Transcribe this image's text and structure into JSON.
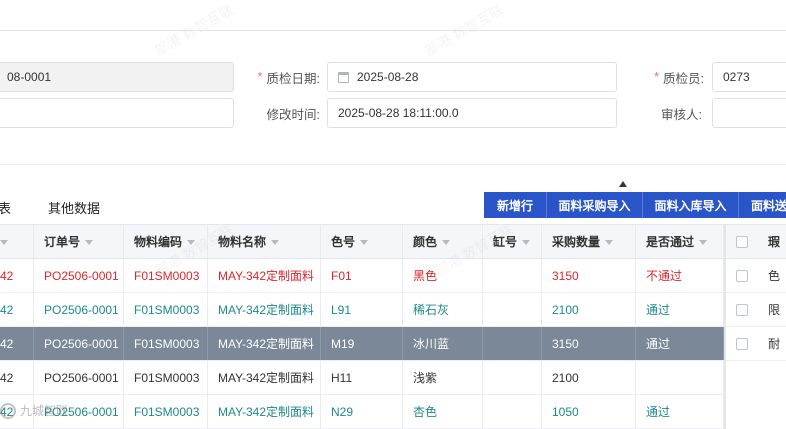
{
  "watermark": {
    "text": "部港 数智互联",
    "bottom_text": "九城智联"
  },
  "form": {
    "code_value": "08-0001",
    "inspect_date_label": "质检日期:",
    "inspect_date_value": "2025-08-28",
    "inspector_label": "质检员:",
    "inspector_value": "0273",
    "modified_time_label": "修改时间:",
    "modified_time_value": "2025-08-28 18:11:00.0",
    "reviewer_label": "审核人:",
    "required_mark": "*"
  },
  "tabs": [
    "表",
    "其他数据"
  ],
  "toolbar": {
    "buttons": [
      "新增行",
      "面料采购导入",
      "面料入库导入",
      "面料送"
    ]
  },
  "table": {
    "columns": [
      "",
      "订单号",
      "物料编码",
      "物料名称",
      "色号",
      "颜色",
      "缸号",
      "采购数量",
      "是否通过"
    ],
    "rows": [
      {
        "c0": "42",
        "order": "PO2506-0001",
        "code": "F01SM0003",
        "name": "MAY-342定制面料",
        "color_no": "F01",
        "color": "黑色",
        "vat": "",
        "qty": "3150",
        "pass": "不通过",
        "tone": "red"
      },
      {
        "c0": "42",
        "order": "PO2506-0001",
        "code": "F01SM0003",
        "name": "MAY-342定制面料",
        "color_no": "L91",
        "color": "稀石灰",
        "vat": "",
        "qty": "2100",
        "pass": "通过",
        "tone": "teal"
      },
      {
        "c0": "42",
        "order": "PO2506-0001",
        "code": "F01SM0003",
        "name": "MAY-342定制面料",
        "color_no": "M19",
        "color": "冰川蓝",
        "vat": "",
        "qty": "3150",
        "pass": "通过",
        "tone": "selected"
      },
      {
        "c0": "42",
        "order": "PO2506-0001",
        "code": "F01SM0003",
        "name": "MAY-342定制面料",
        "color_no": "H11",
        "color": "浅紫",
        "vat": "",
        "qty": "2100",
        "pass": "",
        "tone": "black"
      },
      {
        "c0": "42",
        "order": "PO2506-0001",
        "code": "F01SM0003",
        "name": "MAY-342定制面料",
        "color_no": "N29",
        "color": "杏色",
        "vat": "",
        "qty": "1050",
        "pass": "通过",
        "tone": "teal"
      }
    ]
  },
  "side_panel": {
    "header": "瑕",
    "rows": [
      "色",
      "限",
      "耐"
    ]
  },
  "colors": {
    "accent": "#2a55c8",
    "red": "#e0252b",
    "teal": "#1c8a8a",
    "selected_row": "#7a8898"
  }
}
